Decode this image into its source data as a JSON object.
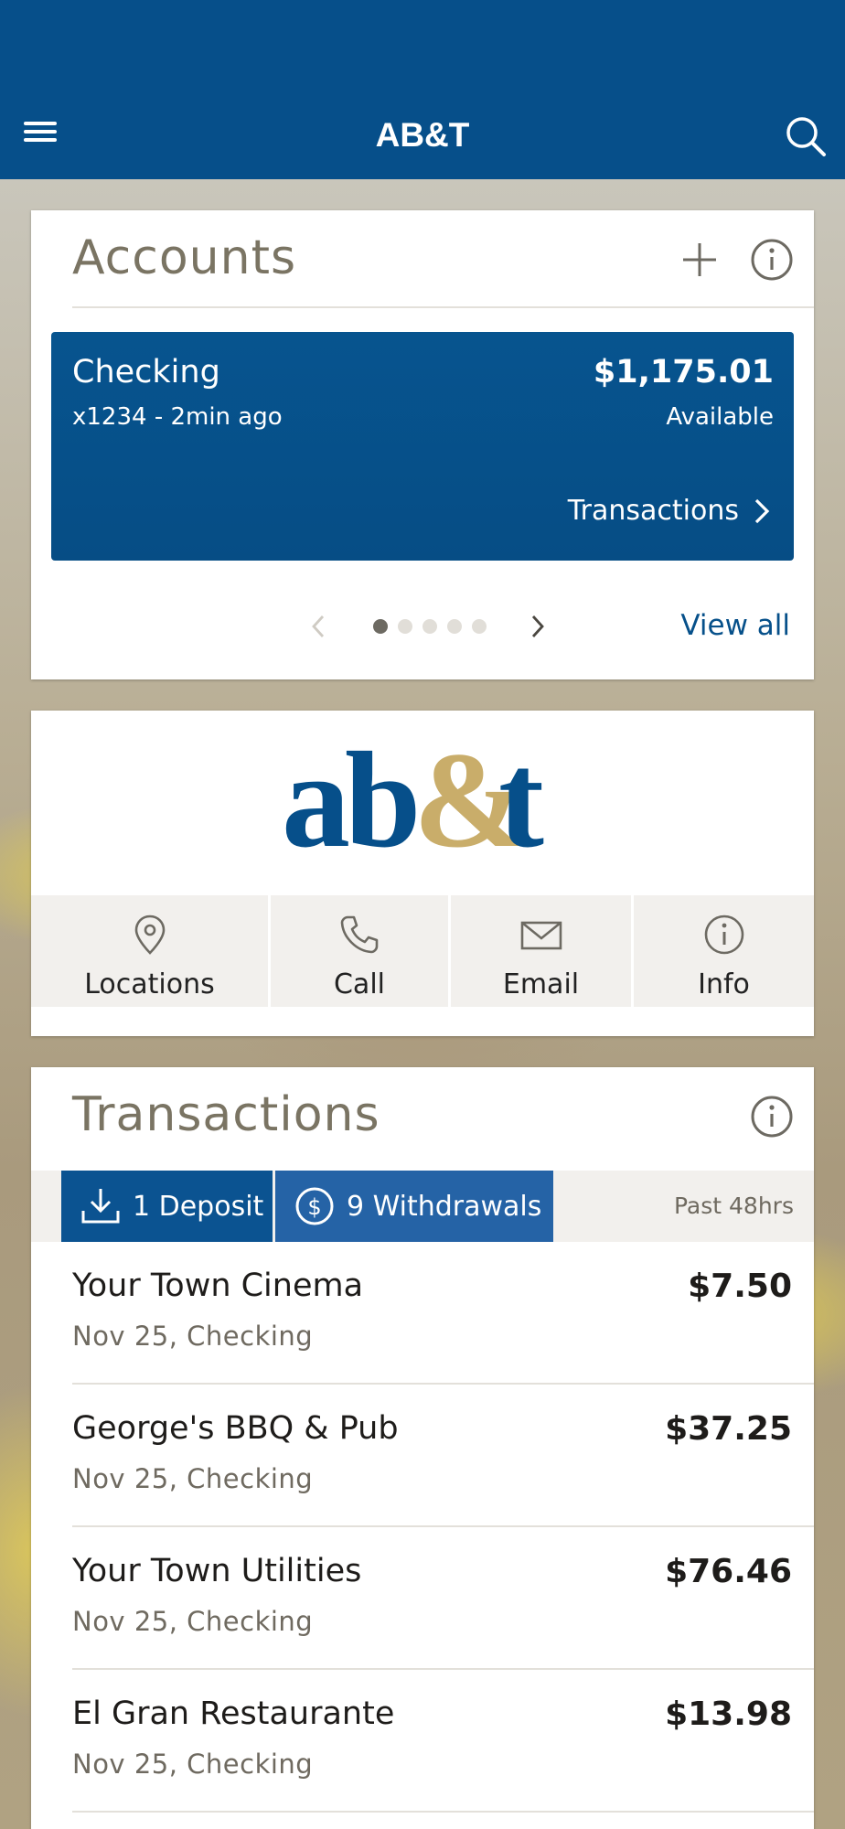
{
  "header": {
    "title": "AB&T"
  },
  "accounts": {
    "title": "Accounts",
    "account": {
      "name": "Checking",
      "subtitle": "x1234 - 2min ago",
      "balance": "$1,175.01",
      "balance_label": "Available",
      "link_label": "Transactions"
    },
    "pager": {
      "total": 5,
      "current": 1
    },
    "view_all": "View all"
  },
  "logo": {
    "text": "ab&t"
  },
  "actions": [
    {
      "label": "Locations",
      "icon": "location-pin-icon"
    },
    {
      "label": "Call",
      "icon": "phone-icon"
    },
    {
      "label": "Email",
      "icon": "envelope-icon"
    },
    {
      "label": "Info",
      "icon": "info-icon"
    }
  ],
  "transactions": {
    "title": "Transactions",
    "deposit_chip": "1 Deposit",
    "withdraw_chip": "9 Withdrawals",
    "period": "Past 48hrs",
    "items": [
      {
        "merchant": "Your Town Cinema",
        "meta": "Nov 25, Checking",
        "amount": "$7.50"
      },
      {
        "merchant": "George's BBQ & Pub",
        "meta": "Nov 25, Checking",
        "amount": "$37.25"
      },
      {
        "merchant": "Your Town Utilities",
        "meta": "Nov 25, Checking",
        "amount": "$76.46"
      },
      {
        "merchant": "El Gran Restaurante",
        "meta": "Nov 25, Checking",
        "amount": "$13.98"
      }
    ]
  },
  "colors": {
    "brand_blue": "#064f8a",
    "brand_gold": "#c9ad6a",
    "muted_text": "#7a7463"
  }
}
